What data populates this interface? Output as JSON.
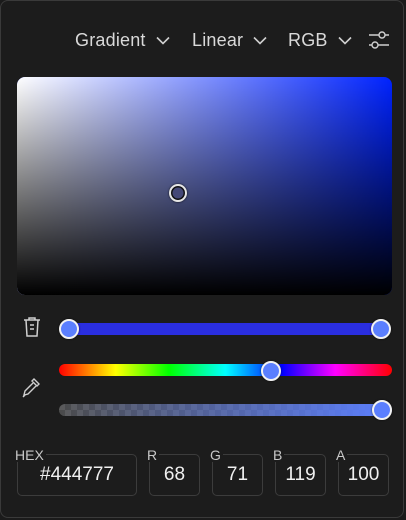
{
  "toolbar": {
    "mode": "Gradient",
    "gradient_type": "Linear",
    "color_model": "RGB"
  },
  "color": {
    "hex": "#444777",
    "r": "68",
    "g": "71",
    "b": "119",
    "a": "100",
    "hue_fraction": 0.644,
    "saturation_fraction": 0.43,
    "value_fraction": 0.47,
    "alpha_fraction": 1.0
  },
  "gradient_stops": [
    {
      "position_fraction": 0.0,
      "color": "#5b7fff"
    },
    {
      "position_fraction": 1.0,
      "color": "#5b7fff"
    }
  ],
  "labels": {
    "hex": "HEX",
    "r": "R",
    "g": "G",
    "b": "B",
    "a": "A"
  },
  "colors": {
    "accent_knob": "#5b7fff",
    "gradient_bar": "#2a2ee0"
  }
}
